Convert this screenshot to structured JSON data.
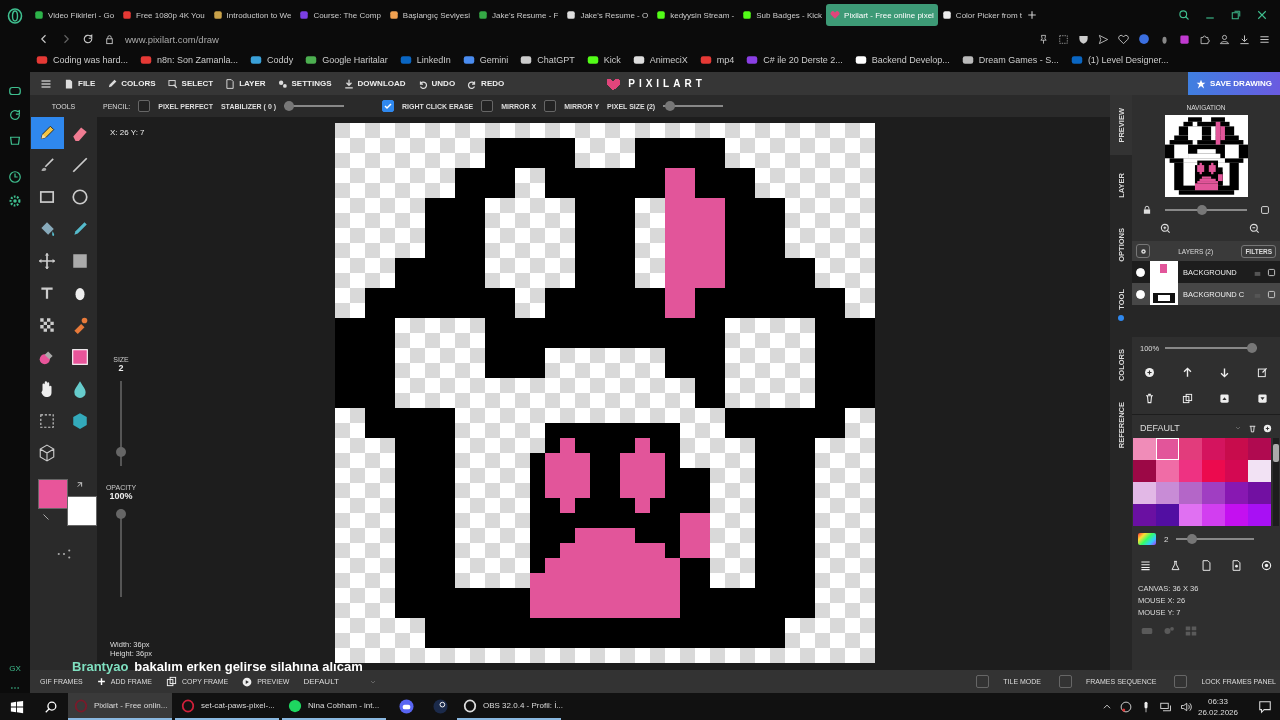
{
  "browser": {
    "tabs": [
      {
        "title": "Video Fikirleri - Go",
        "selected": false
      },
      {
        "title": "Free 1080p 4K You",
        "selected": false
      },
      {
        "title": "Introduction to We",
        "selected": false
      },
      {
        "title": "Course: The Comp",
        "selected": false
      },
      {
        "title": "Başlangıç Seviyesi",
        "selected": false
      },
      {
        "title": "Jake's Resume - F",
        "selected": false
      },
      {
        "title": "Jake's Resume - O",
        "selected": false
      },
      {
        "title": "kedyysin Stream -",
        "selected": false
      },
      {
        "title": "Sub Badges - Kick",
        "selected": false
      },
      {
        "title": "Pixilart - Free online pixel",
        "selected": true
      },
      {
        "title": "Color Picker from t",
        "selected": false
      }
    ],
    "address": "www.pixilart.com/draw",
    "sidebar_label": "GX",
    "bookmarks": [
      "Coding was hard...",
      "n8n: Son Zamanla...",
      "Coddy",
      "Google Haritalar",
      "LinkedIn",
      "Gemini",
      "ChatGPT",
      "Kick",
      "AnimeciX",
      "mp4",
      "C# ile 20 Derste 2...",
      "Backend Develop...",
      "Dream Games - S...",
      "(1) Level Designer..."
    ]
  },
  "app": {
    "menu": [
      "FILE",
      "COLORS",
      "SELECT",
      "LAYER",
      "SETTINGS",
      "DOWNLOAD",
      "UNDO",
      "REDO"
    ],
    "logo": "PIXILART",
    "save_button": "SAVE DRAWING",
    "tool_options": {
      "tool_label": "PENCIL:",
      "pixel_perfect": {
        "label": "PIXEL PERFECT",
        "checked": false
      },
      "stabilizer": {
        "label": "STABILIZER ( 0 )",
        "level": 0
      },
      "right_click_erase": {
        "label": "RIGHT CLICK ERASE",
        "checked": true
      },
      "mirror_x": {
        "label": "MIRROR X",
        "checked": false
      },
      "mirror_y": {
        "label": "MIRROR Y",
        "checked": false
      },
      "pixel_size": {
        "label": "PIXEL SIZE (2)",
        "level": 0.03
      }
    },
    "tools_panel": {
      "title": "TOOLS",
      "tools": [
        {
          "selected": true
        },
        {
          "selected": false
        },
        {
          "selected": false
        },
        {
          "selected": false
        },
        {
          "selected": false
        },
        {
          "selected": false
        },
        {
          "selected": false
        },
        {
          "selected": false
        },
        {
          "selected": false
        },
        {
          "selected": false
        },
        {
          "selected": false
        },
        {
          "selected": false
        },
        {
          "selected": false
        },
        {
          "selected": false
        },
        {
          "selected": false
        },
        {
          "selected": false
        },
        {
          "selected": false
        },
        {
          "selected": false
        },
        {
          "selected": false
        },
        {
          "selected": false
        },
        {
          "selected": false
        }
      ],
      "swatches": [
        {
          "color": "#e8559a"
        },
        {
          "color": "#ffffff"
        }
      ]
    },
    "size": {
      "label": "SIZE",
      "value": "2",
      "level": 0.12
    },
    "opacity": {
      "label": "OPACITY",
      "value": "100%",
      "level": 1
    },
    "canvas": {
      "cursor_position": "X: 26 Y: 7",
      "width": "Width: 36px",
      "height": "Height: 36px"
    },
    "chat_overlay": {
      "user": "Brantyao",
      "message": "bakalım erken gelirse silahına alıcam"
    },
    "side_tabs": [
      {
        "label": "PREVIEW",
        "selected": true,
        "indicator": false
      },
      {
        "label": "LAYER",
        "selected": false,
        "indicator": false
      },
      {
        "label": "OPTIONS",
        "selected": false,
        "indicator": false
      },
      {
        "label": "TOOL",
        "selected": false,
        "indicator": true
      },
      {
        "label": "COLORS",
        "selected": false,
        "indicator": false
      },
      {
        "label": "REFERENCE",
        "selected": false,
        "indicator": false
      }
    ],
    "navigation": {
      "title": "NAVIGATION",
      "zoom": {
        "level": 0.45
      }
    },
    "layers": {
      "title": "LAYERS (2)",
      "filters": "FILTERS",
      "items": [
        {
          "name": "BACKGROUND",
          "visible": true,
          "selected": false
        },
        {
          "name": "BACKGROUND C",
          "visible": true,
          "selected": true
        }
      ],
      "opacity_value": "100%",
      "opacity_slider": {
        "level": 1
      }
    },
    "palette": {
      "name": "DEFAULT",
      "colors": [
        {
          "color": "#f08cb8",
          "selected": false
        },
        {
          "color": "#e2559a",
          "selected": true
        },
        {
          "color": "#e23c7c",
          "selected": false
        },
        {
          "color": "#d4145e",
          "selected": false
        },
        {
          "color": "#c80c4c",
          "selected": false
        },
        {
          "color": "#b00a50",
          "selected": false
        },
        {
          "color": "#9c0846",
          "selected": false
        },
        {
          "color": "#f06ca6",
          "selected": false
        },
        {
          "color": "#ee3282",
          "selected": false
        },
        {
          "color": "#ec0a4e",
          "selected": false
        },
        {
          "color": "#d40852",
          "selected": false
        },
        {
          "color": "#f2e2f4",
          "selected": false
        },
        {
          "color": "#e2b8e6",
          "selected": false
        },
        {
          "color": "#c88cd6",
          "selected": false
        },
        {
          "color": "#b466c8",
          "selected": false
        },
        {
          "color": "#a03ec2",
          "selected": false
        },
        {
          "color": "#8818b2",
          "selected": false
        },
        {
          "color": "#7210a2",
          "selected": false
        },
        {
          "color": "#6a10a2",
          "selected": false
        },
        {
          "color": "#520ea2",
          "selected": false
        },
        {
          "color": "#e070f2",
          "selected": false
        },
        {
          "color": "#d23ef0",
          "selected": false
        },
        {
          "color": "#c410f0",
          "selected": false
        },
        {
          "color": "#a810f4",
          "selected": false
        }
      ]
    },
    "brush": {
      "value": "2",
      "level": 0.15
    },
    "info": [
      "CANVAS: 36 X 36",
      "MOUSE X: 26",
      "MOUSE Y: 7"
    ],
    "frames_bar": {
      "title": "GIF FRAMES",
      "buttons": [
        "ADD FRAME",
        "COPY FRAME",
        "PREVIEW"
      ],
      "frame_set": "DEFAULT",
      "toggles": [
        {
          "label": "TILE MODE",
          "checked": false
        },
        {
          "label": "FRAMES SEQUENCE",
          "checked": false
        },
        {
          "label": "LOCK FRAMES PANEL",
          "checked": false
        }
      ]
    }
  },
  "taskbar": {
    "apps": [
      {
        "kind": "window",
        "title": "Pixilart - Free onlin...",
        "selected": true
      },
      {
        "kind": "window",
        "title": "set-cat-paws-pixel-...",
        "selected": false
      },
      {
        "kind": "window",
        "title": "Nina Cobham - int...",
        "selected": false
      },
      {
        "kind": "icon",
        "selected": false
      },
      {
        "kind": "icon",
        "selected": false
      },
      {
        "kind": "window",
        "title": "OBS 32.0.4 - Profil: İ...",
        "selected": false
      }
    ],
    "time": "06:33",
    "date": "26.02.2026"
  }
}
